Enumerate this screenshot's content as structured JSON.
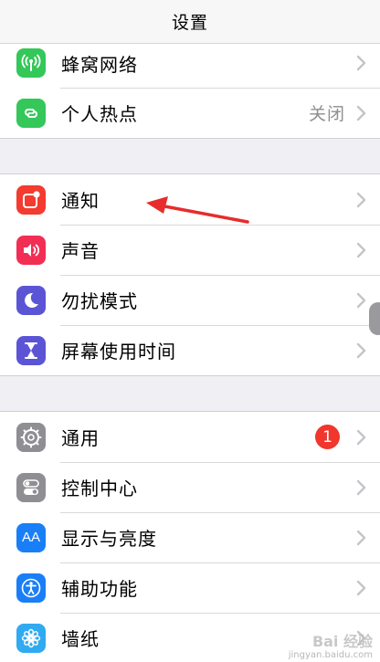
{
  "header": {
    "title": "设置"
  },
  "group1": {
    "items": [
      {
        "label": "蜂窝网络",
        "icon": "cellular-antenna-icon",
        "color": "#34c759"
      },
      {
        "label": "个人热点",
        "value": "关闭",
        "icon": "hotspot-chain-icon",
        "color": "#34c759"
      }
    ]
  },
  "group2": {
    "items": [
      {
        "label": "通知",
        "icon": "notifications-icon",
        "color": "#f33b30"
      },
      {
        "label": "声音",
        "icon": "speaker-icon",
        "color": "#f22e55"
      },
      {
        "label": "勿扰模式",
        "icon": "moon-icon",
        "color": "#5b55d6"
      },
      {
        "label": "屏幕使用时间",
        "icon": "hourglass-icon",
        "color": "#5b55d6"
      }
    ]
  },
  "group3": {
    "items": [
      {
        "label": "通用",
        "badge": "1",
        "icon": "gear-icon",
        "color": "#8e8e93"
      },
      {
        "label": "控制中心",
        "icon": "toggles-icon",
        "color": "#8e8e93"
      },
      {
        "label": "显示与亮度",
        "icon_text": "AA",
        "icon": "display-aa-icon",
        "color": "#1a7ff6"
      },
      {
        "label": "辅助功能",
        "icon": "accessibility-icon",
        "color": "#1a7ff6"
      },
      {
        "label": "墙纸",
        "icon": "flower-icon",
        "color": "#30aaf0"
      }
    ]
  },
  "annotation": {
    "color": "#e62c2c"
  },
  "watermark": {
    "text": "Bai 经验",
    "sub": "jingyan.baidu.com"
  }
}
